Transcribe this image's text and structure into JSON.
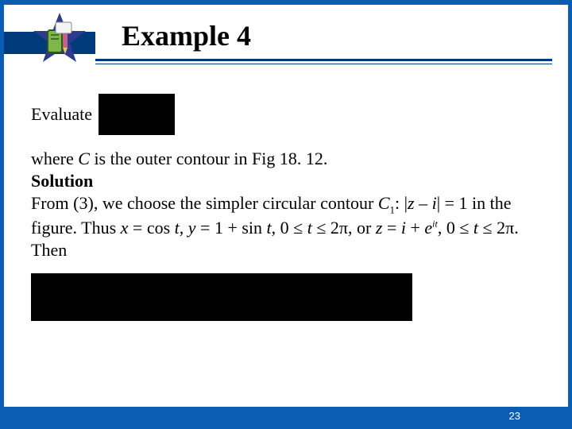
{
  "header": {
    "title": "Example 4"
  },
  "body": {
    "evaluate_label": "Evaluate",
    "line_where": "where C is the outer contour in Fig 18. 12.",
    "solution_label": "Solution",
    "line_from3": "From (3), we choose the simpler circular contour C",
    "c1_sub": "1",
    "c1_after": ": |z – i|  = 1 in the figure. Thus x = cos t, y = 1 + sin t, 0 ≤ t ≤ 2π, or z = i + e",
    "exp_it": "it",
    "after_exp": ", 0 ≤ t ≤ 2π. Then"
  },
  "footer": {
    "page": "23"
  }
}
